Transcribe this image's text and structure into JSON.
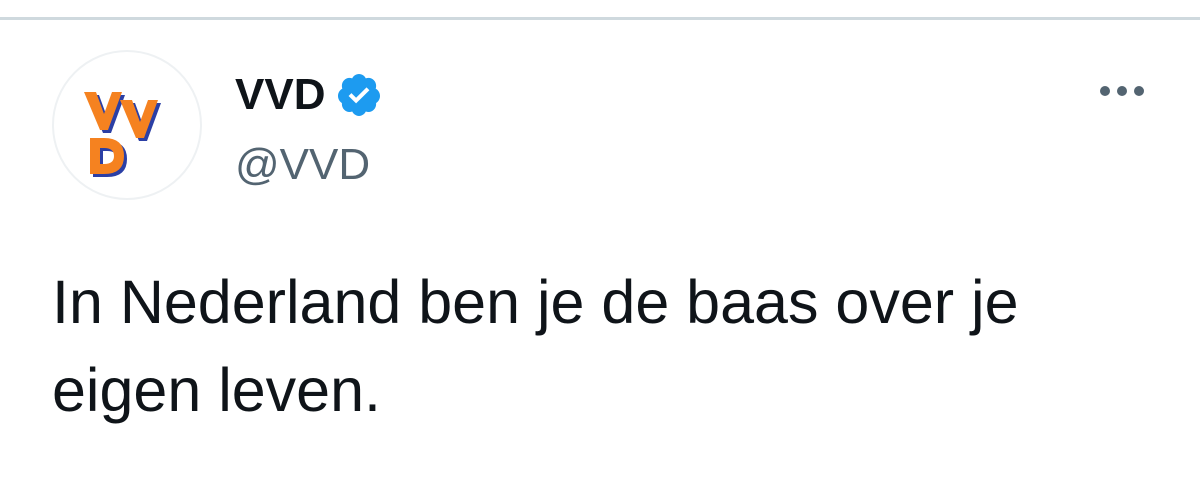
{
  "tweet": {
    "author": {
      "name": "VVD",
      "handle": "@VVD",
      "verified": true,
      "avatar": {
        "logo_text": "VVD",
        "colors": {
          "orange": "#f58220",
          "blue": "#2b3fa5"
        }
      }
    },
    "text": "In Nederland ben je de baas over je eigen leven.",
    "more_icon": "more-horizontal-icon",
    "verified_icon": "verified-badge-icon"
  },
  "colors": {
    "text_primary": "#0f1419",
    "text_secondary": "#536471",
    "verified_blue": "#1d9bf0",
    "divider": "#cfd9de"
  }
}
